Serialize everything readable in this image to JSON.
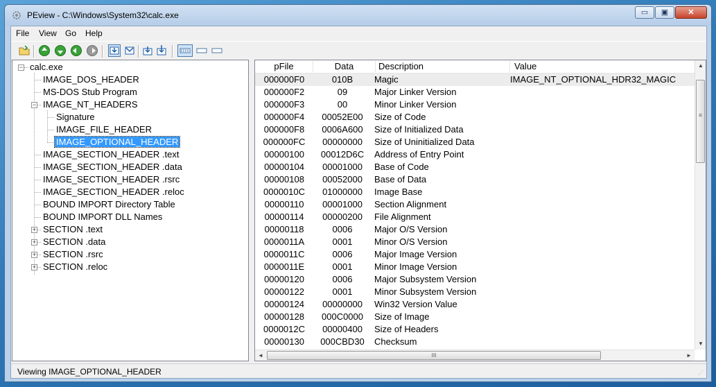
{
  "window": {
    "title": "PEview - C:\\Windows\\System32\\calc.exe",
    "min_glyph": "▭",
    "max_glyph": "▣",
    "close_glyph": "✕"
  },
  "menu": [
    "File",
    "View",
    "Go",
    "Help"
  ],
  "toolbar": {
    "buttons": [
      "open-icon",
      "nav-up-icon",
      "nav-down-icon",
      "nav-back-icon",
      "nav-forward-icon",
      "view-raw-icon",
      "view-header-icon",
      "view-section-icon",
      "view-import-icon",
      "view-list-icon",
      "view-small-icon",
      "view-details-icon"
    ]
  },
  "tree": {
    "root": "calc.exe",
    "nodes": [
      {
        "label": "IMAGE_DOS_HEADER"
      },
      {
        "label": "MS-DOS Stub Program"
      },
      {
        "label": "IMAGE_NT_HEADERS",
        "expander": "−"
      },
      {
        "label": "Signature"
      },
      {
        "label": "IMAGE_FILE_HEADER"
      },
      {
        "label": "IMAGE_OPTIONAL_HEADER",
        "selected": true
      },
      {
        "label": "IMAGE_SECTION_HEADER .text"
      },
      {
        "label": "IMAGE_SECTION_HEADER .data"
      },
      {
        "label": "IMAGE_SECTION_HEADER .rsrc"
      },
      {
        "label": "IMAGE_SECTION_HEADER .reloc"
      },
      {
        "label": "BOUND IMPORT Directory Table"
      },
      {
        "label": "BOUND IMPORT DLL Names"
      },
      {
        "label": "SECTION .text",
        "expander": "+"
      },
      {
        "label": "SECTION .data",
        "expander": "+"
      },
      {
        "label": "SECTION .rsrc",
        "expander": "+"
      },
      {
        "label": "SECTION .reloc",
        "expander": "+"
      }
    ],
    "root_expander": "−"
  },
  "list": {
    "columns": [
      "pFile",
      "Data",
      "Description",
      "Value"
    ],
    "rows": [
      [
        "000000F0",
        "010B",
        "Magic",
        "IMAGE_NT_OPTIONAL_HDR32_MAGIC"
      ],
      [
        "000000F2",
        "09",
        "Major Linker Version",
        ""
      ],
      [
        "000000F3",
        "00",
        "Minor Linker Version",
        ""
      ],
      [
        "000000F4",
        "00052E00",
        "Size of Code",
        ""
      ],
      [
        "000000F8",
        "0006A600",
        "Size of Initialized Data",
        ""
      ],
      [
        "000000FC",
        "00000000",
        "Size of Uninitialized Data",
        ""
      ],
      [
        "00000100",
        "00012D6C",
        "Address of Entry Point",
        ""
      ],
      [
        "00000104",
        "00001000",
        "Base of Code",
        ""
      ],
      [
        "00000108",
        "00052000",
        "Base of Data",
        ""
      ],
      [
        "0000010C",
        "01000000",
        "Image Base",
        ""
      ],
      [
        "00000110",
        "00001000",
        "Section Alignment",
        ""
      ],
      [
        "00000114",
        "00000200",
        "File Alignment",
        ""
      ],
      [
        "00000118",
        "0006",
        "Major O/S Version",
        ""
      ],
      [
        "0000011A",
        "0001",
        "Minor O/S Version",
        ""
      ],
      [
        "0000011C",
        "0006",
        "Major Image Version",
        ""
      ],
      [
        "0000011E",
        "0001",
        "Minor Image Version",
        ""
      ],
      [
        "00000120",
        "0006",
        "Major Subsystem Version",
        ""
      ],
      [
        "00000122",
        "0001",
        "Minor Subsystem Version",
        ""
      ],
      [
        "00000124",
        "00000000",
        "Win32 Version Value",
        ""
      ],
      [
        "00000128",
        "000C0000",
        "Size of Image",
        ""
      ],
      [
        "0000012C",
        "00000400",
        "Size of Headers",
        ""
      ],
      [
        "00000130",
        "000CBD30",
        "Checksum",
        ""
      ]
    ]
  },
  "scroll": {
    "up_glyph": "▲",
    "down_glyph": "▼",
    "left_glyph": "◄",
    "right_glyph": "►",
    "grip": "≡",
    "hgrip": "III"
  },
  "status": {
    "text": "Viewing IMAGE_OPTIONAL_HEADER"
  }
}
